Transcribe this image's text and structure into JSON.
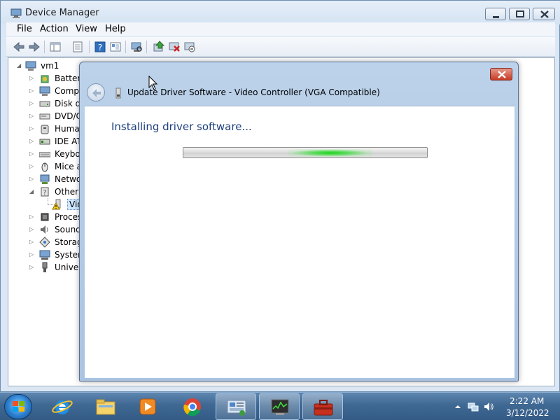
{
  "window": {
    "title": "Device Manager",
    "icon": "device-manager-icon"
  },
  "menu": [
    "File",
    "Action",
    "View",
    "Help"
  ],
  "toolbar": {
    "icons": [
      "back-arrow-icon",
      "forward-arrow-icon",
      "show-hide-tree-icon",
      "properties-icon",
      "help-icon",
      "view-icon",
      "scan-hardware-icon",
      "update-driver-icon",
      "uninstall-icon",
      "disable-device-icon"
    ]
  },
  "tree": {
    "root": "vm1",
    "items": [
      {
        "label": "Batterie",
        "icon": "battery-icon",
        "expand": "▷"
      },
      {
        "label": "Compu",
        "icon": "computer-icon",
        "expand": "▷"
      },
      {
        "label": "Disk dr",
        "icon": "disk-drive-icon",
        "expand": "▷"
      },
      {
        "label": "DVD/C",
        "icon": "dvd-icon",
        "expand": "▷"
      },
      {
        "label": "Human",
        "icon": "hid-icon",
        "expand": "▷"
      },
      {
        "label": "IDE AT",
        "icon": "ide-controller-icon",
        "expand": "▷"
      },
      {
        "label": "Keyboa",
        "icon": "keyboard-icon",
        "expand": "▷"
      },
      {
        "label": "Mice a",
        "icon": "mouse-icon",
        "expand": "▷"
      },
      {
        "label": "Netwo",
        "icon": "network-icon",
        "expand": "▷"
      },
      {
        "label": "Other d",
        "icon": "other-devices-icon",
        "expand": "◢"
      },
      {
        "label": "Vid",
        "icon": "warning-device-icon",
        "expand": "",
        "child": true
      },
      {
        "label": "Proces",
        "icon": "processor-icon",
        "expand": "▷"
      },
      {
        "label": "Sound,",
        "icon": "sound-icon",
        "expand": "▷"
      },
      {
        "label": "Storage",
        "icon": "storage-icon",
        "expand": "▷"
      },
      {
        "label": "System",
        "icon": "system-devices-icon",
        "expand": "▷"
      },
      {
        "label": "Univers",
        "icon": "usb-icon",
        "expand": "▷"
      }
    ]
  },
  "dialog": {
    "title": "Update Driver Software - Video Controller (VGA Compatible)",
    "heading": "Installing driver software...",
    "progress_state": "indeterminate",
    "close_icon": "close-icon",
    "back_icon": "back-arrow-icon"
  },
  "taskbar": {
    "start_icon": "windows-start-icon",
    "pinned": [
      "internet-explorer-icon",
      "file-explorer-icon",
      "media-player-icon",
      "chrome-icon",
      "control-panel-icon",
      "task-manager-icon",
      "device-manager-taskbar-icon"
    ],
    "tray_icons": [
      "show-hidden-icons-chevron",
      "network-icon",
      "volume-icon"
    ],
    "time": "2:22 AM",
    "date": "3/12/2022"
  },
  "colors": {
    "dialog_heading": "#1e3f7e",
    "progress_glow": "#1ed21e",
    "taskbar": "#3f6893",
    "dialog_close": "#c63b25"
  }
}
